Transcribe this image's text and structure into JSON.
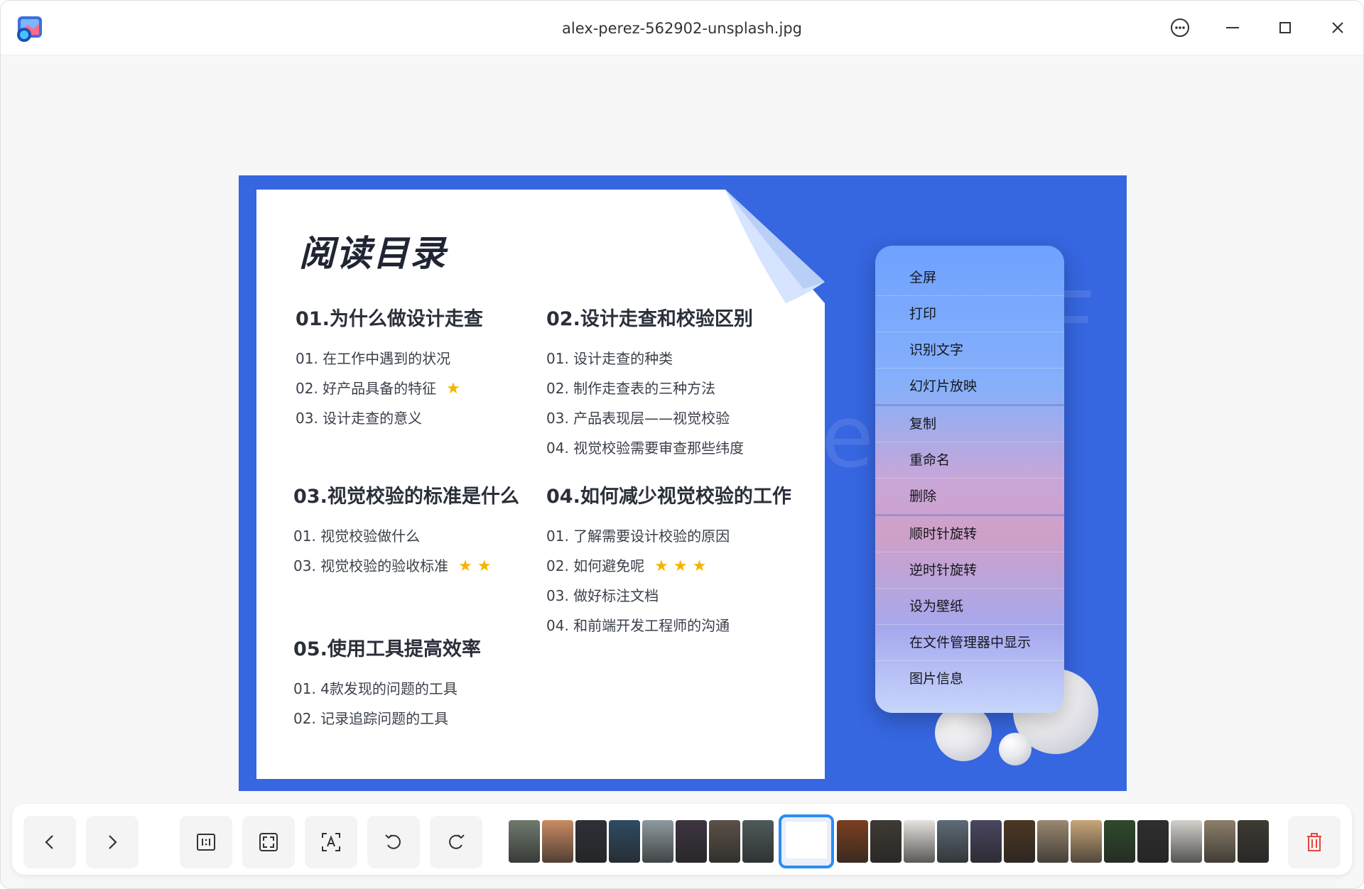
{
  "window": {
    "title": "alex-perez-562902-unsplash.jpg",
    "icons": [
      "app-logo-icon",
      "more-options-icon",
      "minimize-icon",
      "maximize-icon",
      "close-icon"
    ]
  },
  "document": {
    "title": "阅读目录",
    "sections": [
      {
        "heading": "01.为什么做设计走查",
        "items": [
          {
            "text": "01. 在工作中遇到的状况",
            "stars": ""
          },
          {
            "text": "02. 好产品具备的特征",
            "stars": "★"
          },
          {
            "text": "03. 设计走查的意义",
            "stars": ""
          }
        ]
      },
      {
        "heading": "02.设计走查和校验区别",
        "items": [
          {
            "text": "01. 设计走查的种类",
            "stars": ""
          },
          {
            "text": "02. 制作走查表的三种方法",
            "stars": ""
          },
          {
            "text": "03. 产品表现层——视觉校验",
            "stars": ""
          },
          {
            "text": "04. 视觉校验需要审查那些纬度",
            "stars": ""
          }
        ]
      },
      {
        "heading": "03.视觉校验的标准是什么",
        "items": [
          {
            "text": "01. 视觉校验做什么",
            "stars": ""
          },
          {
            "text": "03. 视觉校验的验收标准",
            "stars": "★ ★"
          }
        ]
      },
      {
        "heading": "04.如何减少视觉校验的工作",
        "items": [
          {
            "text": "01. 了解需要设计校验的原因",
            "stars": ""
          },
          {
            "text": "02. 如何避免呢",
            "stars": "★ ★ ★"
          },
          {
            "text": "03. 做好标注文档",
            "stars": ""
          },
          {
            "text": "04. 和前端开发工程师的沟通",
            "stars": ""
          }
        ]
      },
      {
        "heading": "05.使用工具提高效率",
        "items": [
          {
            "text": "01. 4款发现的问题的工具",
            "stars": ""
          },
          {
            "text": "02. 记录追踪问题的工具",
            "stars": ""
          }
        ]
      }
    ]
  },
  "context_menu": {
    "items": [
      "全屏",
      "打印",
      "识别文字",
      "幻灯片放映",
      "复制",
      "重命名",
      "删除",
      "顺时针旋转",
      "逆时针旋转",
      "设为壁纸",
      "在文件管理器中显示",
      "图片信息"
    ]
  },
  "toolbar": {
    "buttons": [
      "previous-icon",
      "next-icon",
      "original-size-icon",
      "fit-window-icon",
      "ocr-icon",
      "rotate-counterclockwise-icon",
      "rotate-clockwise-icon"
    ],
    "delete_icon": "trash-icon",
    "accent_color": "#2b8cf5",
    "delete_color": "#e8453c"
  },
  "thumbnails": {
    "colors": [
      "#6f7a6e",
      "#c98b63",
      "#2d3036",
      "#2f4b63",
      "#8e9aa0",
      "#3d3540",
      "#5b5248",
      "#505a5a",
      "current",
      "#7a3f1f",
      "#3f3a33",
      "#e5e3de",
      "#5e6b76",
      "#4a4660",
      "#4d3623",
      "#9a8870",
      "#c9a679",
      "#2e4a2a",
      "#2f2f2f",
      "#d3d1cc",
      "#8d7f6a",
      "#3e3a34"
    ]
  }
}
